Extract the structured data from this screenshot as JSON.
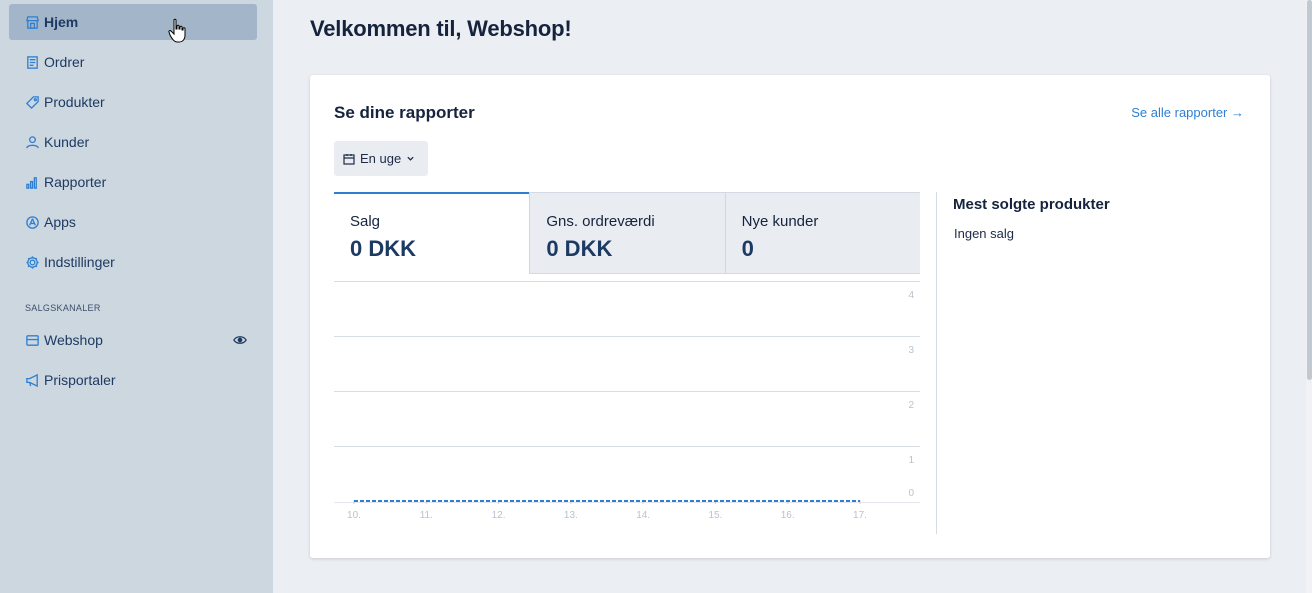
{
  "sidebar": {
    "items": [
      {
        "label": "Hjem",
        "icon": "store-icon",
        "active": true
      },
      {
        "label": "Ordrer",
        "icon": "receipt-icon"
      },
      {
        "label": "Produkter",
        "icon": "tag-icon"
      },
      {
        "label": "Kunder",
        "icon": "user-icon"
      },
      {
        "label": "Rapporter",
        "icon": "bar-chart-icon"
      },
      {
        "label": "Apps",
        "icon": "apps-icon"
      },
      {
        "label": "Indstillinger",
        "icon": "gear-icon"
      }
    ],
    "section_label": "SALGSKANALER",
    "channels": [
      {
        "label": "Webshop",
        "icon": "storefront-icon"
      },
      {
        "label": "Prisportaler",
        "icon": "megaphone-icon"
      }
    ]
  },
  "main": {
    "title": "Velkommen til, Webshop!",
    "reports": {
      "title": "Se dine rapporter",
      "see_all": "Se alle rapporter →",
      "period": "En uge",
      "tabs": [
        {
          "label": "Salg",
          "value": "0 DKK"
        },
        {
          "label": "Gns. ordreværdi",
          "value": "0 DKK"
        },
        {
          "label": "Nye kunder",
          "value": "0"
        }
      ],
      "best_sellers_title": "Mest solgte produkter",
      "best_sellers_empty": "Ingen salg"
    }
  },
  "colors": {
    "accent": "#2f7fd1",
    "sidebar": "#cdd7df",
    "active": "#a3b5c9"
  },
  "chart_data": {
    "type": "line",
    "x": [
      "10.",
      "11.",
      "12.",
      "13.",
      "14.",
      "15.",
      "16.",
      "17."
    ],
    "series": [
      {
        "values": [
          0,
          0,
          0,
          0,
          0,
          0,
          0,
          0
        ]
      }
    ],
    "y_ticks": [
      "4",
      "3",
      "2",
      "1",
      "0"
    ],
    "ylim": [
      0,
      4
    ],
    "grid": true
  }
}
